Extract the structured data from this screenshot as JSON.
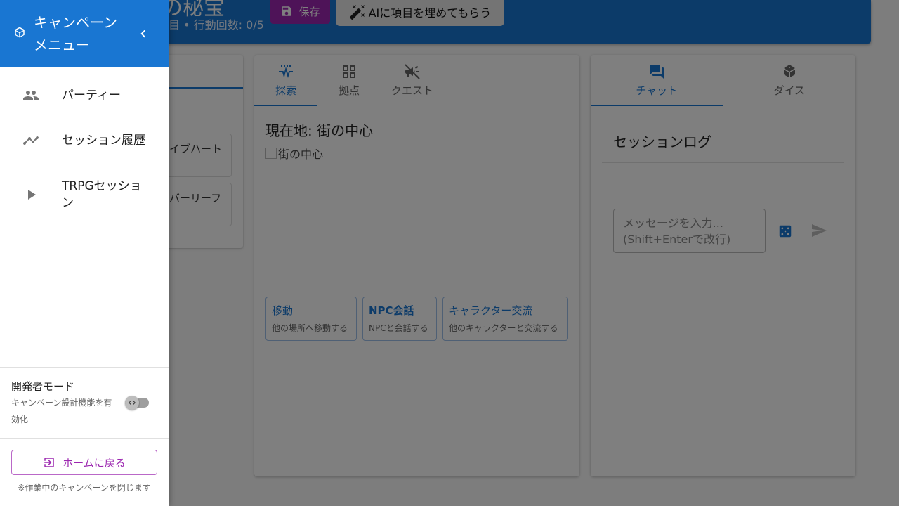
{
  "appbar": {
    "title_fragment": "の秘宝",
    "subtitle": "目 • 行動回数: 0/5",
    "save_label": "保存",
    "ai_fill_label": "AIに項目を埋めてもらう"
  },
  "left_panel": {
    "cards": [
      "イブハート",
      "バーリーフ"
    ]
  },
  "center_panel": {
    "tabs": [
      {
        "label": "探索",
        "icon": "explore-pulse-icon",
        "active": true
      },
      {
        "label": "拠点",
        "icon": "dashboard-icon",
        "active": false
      },
      {
        "label": "クエスト",
        "icon": "quest-campaign-icon",
        "active": false
      }
    ],
    "location_title": "現在地: 街の中心",
    "image_alt": "街の中心",
    "actions": [
      {
        "title": "移動",
        "desc": "他の場所へ移動する"
      },
      {
        "title": "NPC会話",
        "desc": "NPCと会話する"
      },
      {
        "title": "キャラクター交流",
        "desc": "他のキャラクターと交流する"
      }
    ]
  },
  "right_panel": {
    "tabs": [
      {
        "label": "チャット",
        "icon": "forum-icon",
        "active": true
      },
      {
        "label": "ダイス",
        "icon": "dice-icon",
        "active": false
      }
    ],
    "log_title": "セッションログ",
    "message_placeholder_line1": "メッセージを入力...",
    "message_placeholder_line2": "(Shift+Enterで改行)"
  },
  "drawer": {
    "title_line1": "キャンペーン",
    "title_line2": "メニュー",
    "items": [
      {
        "label": "パーティー",
        "icon": "group-icon"
      },
      {
        "label": "セッション履歴",
        "icon": "timeline-icon"
      },
      {
        "label_line1": "TRPGセッショ",
        "label_line2": "ン",
        "icon": "play-arrow-icon"
      }
    ],
    "dev_mode": {
      "title": "開発者モード",
      "desc": "キャンペーン設計機能を有効化",
      "enabled": false
    },
    "home_button_label": "ホームに戻る",
    "home_note": "※作業中のキャンペーンを閉じます"
  },
  "colors": {
    "primary": "#1976d2",
    "secondary": "#9c27b0",
    "scrim": "rgba(0,0,0,0.5)"
  }
}
